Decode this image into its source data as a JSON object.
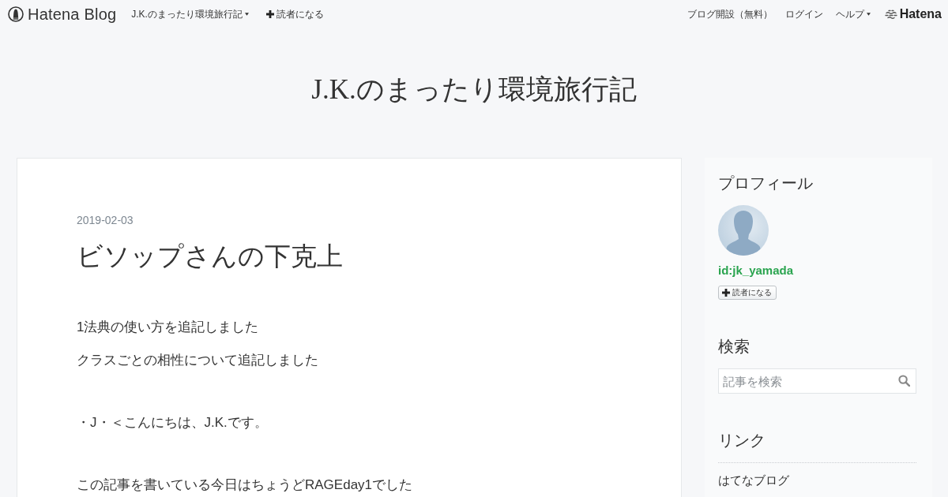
{
  "topbar": {
    "logo": "Hatena Blog",
    "left_links": [
      {
        "label": "J.K.のまったり環境旅行記",
        "kind": "dropdown"
      },
      {
        "label": "読者になる",
        "kind": "subscribe"
      }
    ],
    "right_links": [
      {
        "label": "ブログ開設（無料）",
        "kind": "link"
      },
      {
        "label": "ログイン",
        "kind": "link"
      },
      {
        "label": "ヘルプ",
        "kind": "dropdown"
      }
    ],
    "brand": "Hatena"
  },
  "blog_title": "J.K.のまったり環境旅行記",
  "article": {
    "date": "2019-02-03",
    "title": "ビソップさんの下克上",
    "paragraph_groups": [
      [
        "1法典の使い方を追記しました",
        "クラスごとの相性について追記しました"
      ],
      [
        "・J・＜こんにちは、J.K.です。"
      ],
      [
        "この記事を書いている今日はちょうどRAGEday1でした"
      ]
    ]
  },
  "sidebar": {
    "profile": {
      "heading": "プロフィール",
      "user_id": "id:jk_yamada",
      "subscribe_button": "読者になる"
    },
    "search": {
      "heading": "検索",
      "placeholder": "記事を検索"
    },
    "links": {
      "heading": "リンク",
      "items": [
        "はてなブログ"
      ]
    }
  }
}
